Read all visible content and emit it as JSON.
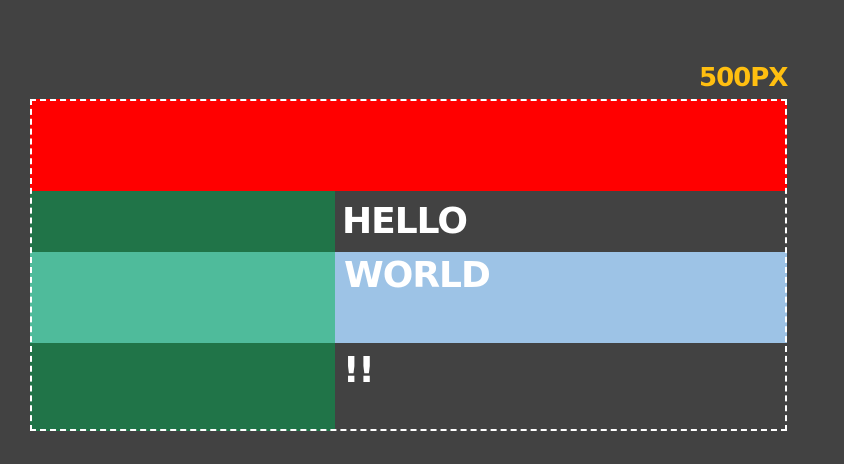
{
  "width_label": "500PX",
  "words": {
    "hello": "HELLO",
    "world": "WORLD",
    "bang": "!!"
  },
  "colors": {
    "background": "#424242",
    "label": "#ffbf10",
    "red": "#ff0000",
    "dark_green": "#207448",
    "teal": "#4fbb9b",
    "light_blue": "#9dc3e6",
    "text": "#ffffff",
    "border": "#ffffff"
  }
}
